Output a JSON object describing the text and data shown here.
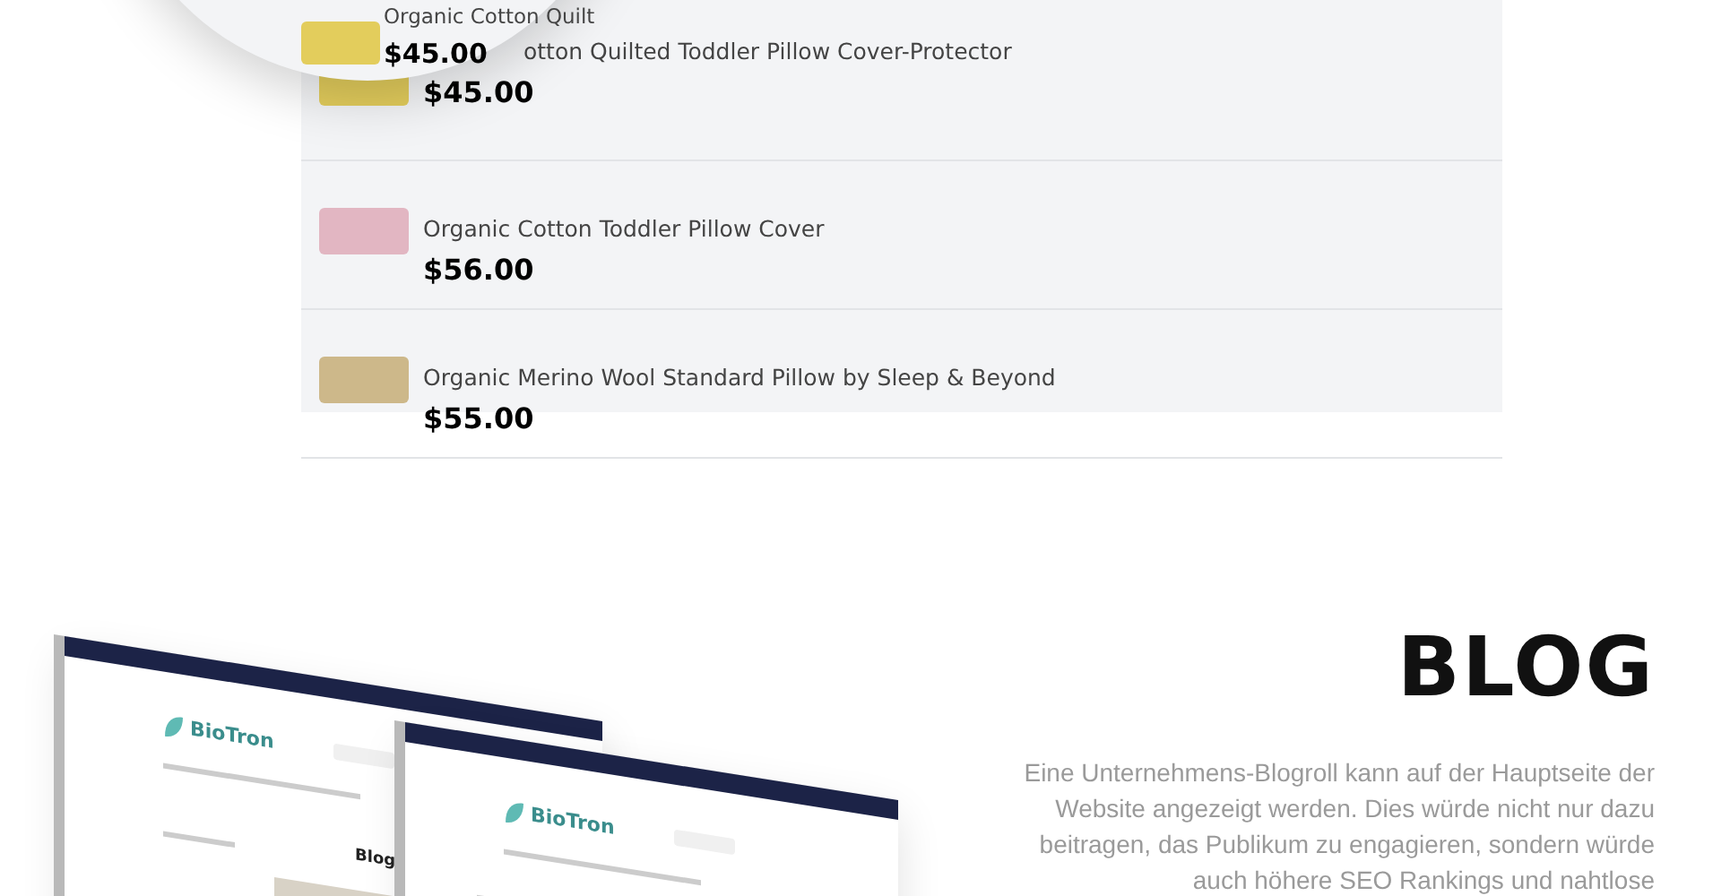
{
  "products": [
    {
      "kind": "covered",
      "title": "otton Quilted Toddler Pillow Cover-Protector",
      "price": "$45.00",
      "color": "#e3cd5c"
    },
    {
      "kind": "plain",
      "title": "Organic Cotton Toddler Pillow Cover",
      "price": "$56.00",
      "color": "#e2b6c2"
    },
    {
      "kind": "plain",
      "title": "Organic Merino Wool Standard Pillow by Sleep & Beyond",
      "price": "$55.00",
      "color": "#cdb88a"
    }
  ],
  "magnifier": {
    "title": "Organic Cotton Quilt",
    "price": "$45.00",
    "color": "#e3cd5c"
  },
  "blog": {
    "heading": "BLOG",
    "text": "Eine Unternehmens-Blogroll kann auf der Hauptseite der Website angezeigt werden. Dies würde nicht nur dazu beitragen, das Publikum zu engagieren, sondern würde auch höhere SEO Rankings und nahtlose"
  },
  "mockups": [
    {
      "logo": "BioTron",
      "heading": "Blog"
    },
    {
      "logo": "BioTron"
    }
  ]
}
